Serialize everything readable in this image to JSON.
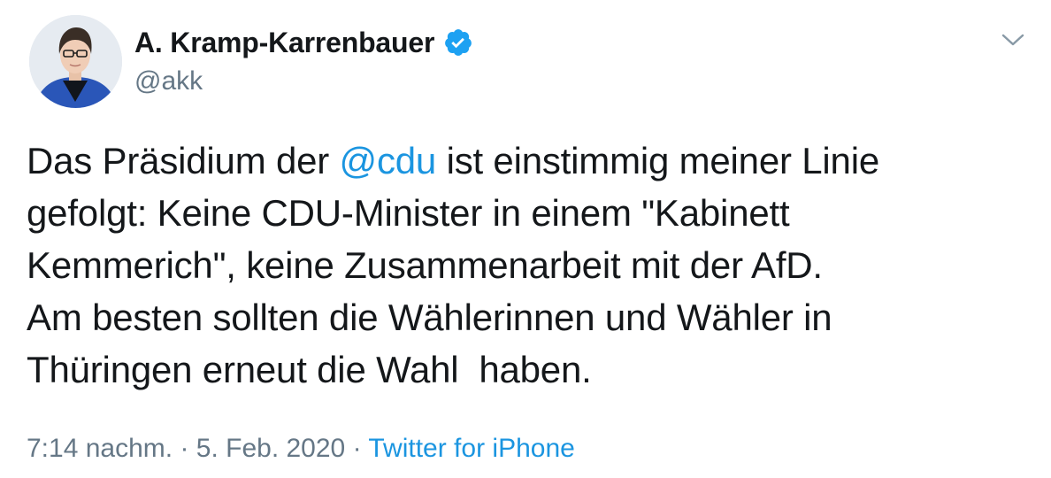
{
  "tweet": {
    "author": {
      "display_name": "A. Kramp-Karrenbauer",
      "handle": "@akk",
      "verified": true,
      "avatar_icon": "profile-photo"
    },
    "text_lines": [
      {
        "before": "Das Präsidium der ",
        "mention": "@cdu",
        "after": " ist einstimmig meiner Linie"
      },
      {
        "text": "gefolgt: Keine CDU-Minister in einem \"Kabinett"
      },
      {
        "text": "Kemmerich\", keine Zusammenarbeit mit der AfD."
      },
      {
        "text": "Am besten sollten die Wählerinnen und Wähler in"
      },
      {
        "text": "Thüringen erneut die Wahl  haben."
      }
    ],
    "meta": {
      "time": "7:14 nachm.",
      "separator": " · ",
      "date": "5. Feb. 2020",
      "source": "Twitter for iPhone"
    },
    "menu_icon": "chevron-down-icon"
  },
  "colors": {
    "text": "#14171a",
    "secondary": "#657786",
    "link": "#1b95e0",
    "verified": "#1da1f2"
  }
}
